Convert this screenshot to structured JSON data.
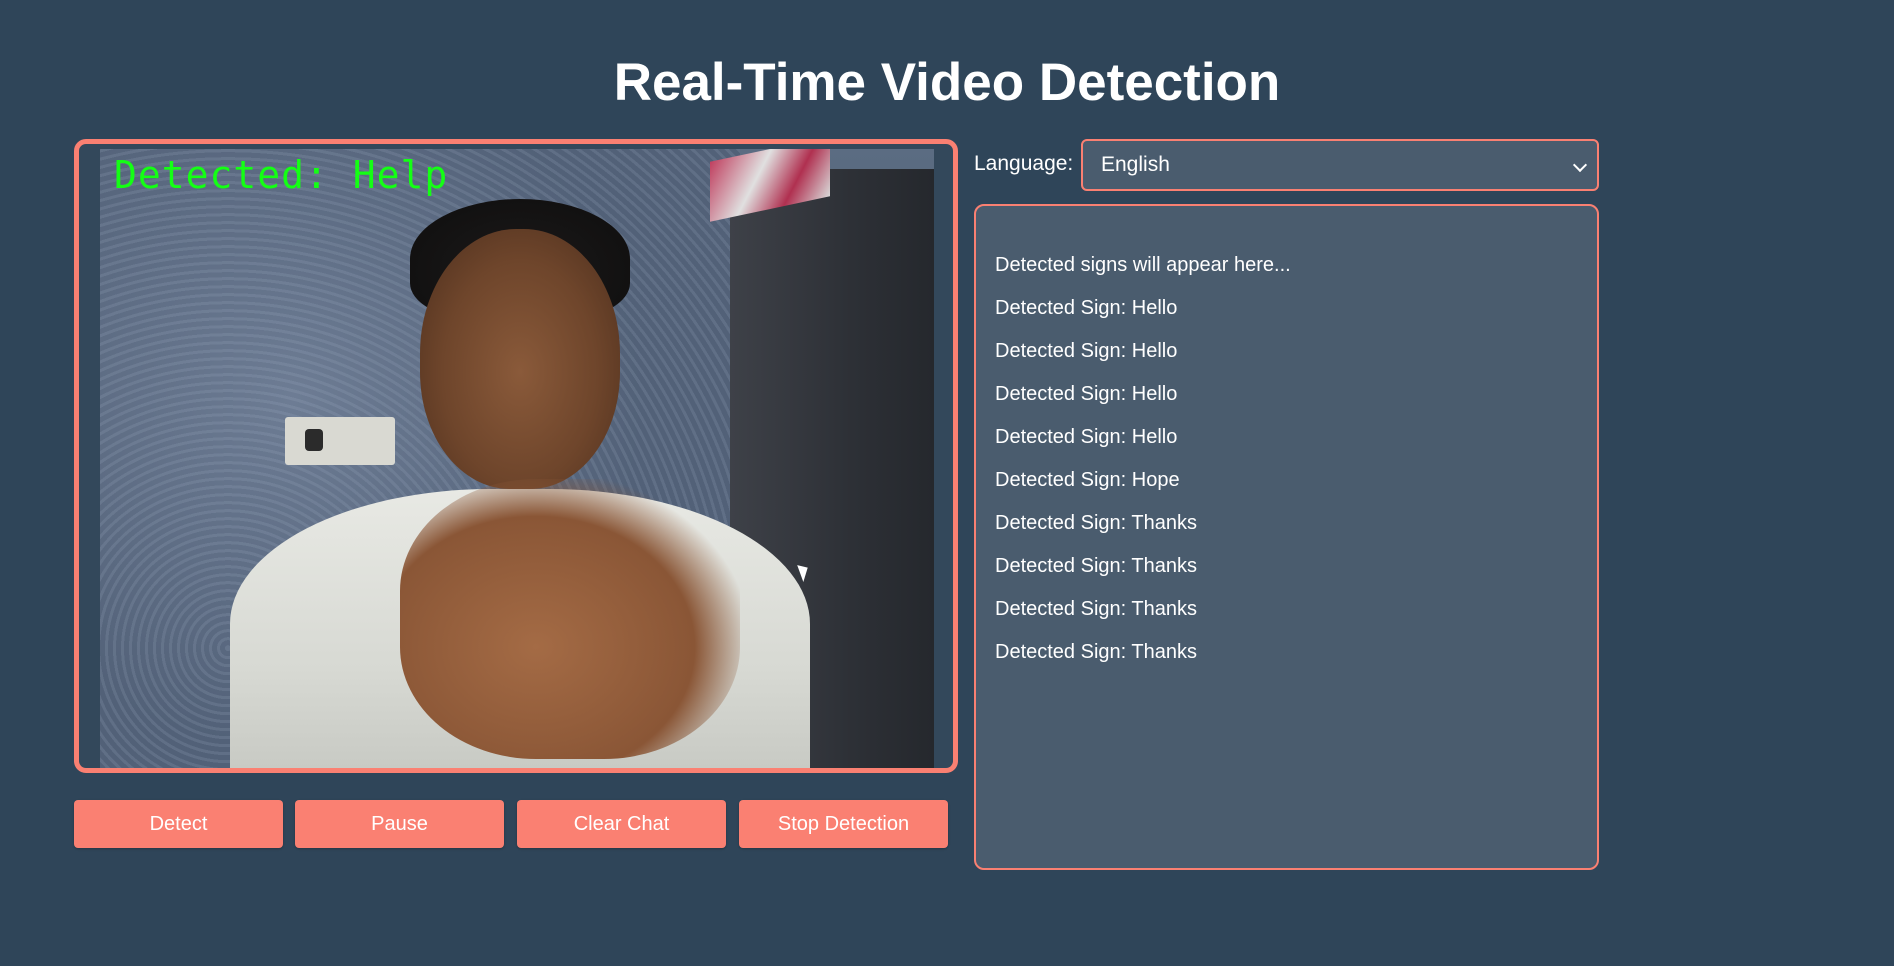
{
  "page": {
    "title": "Real-Time Video Detection"
  },
  "video": {
    "overlay_text": "Detected: Help",
    "accent_color": "#14ff14"
  },
  "controls": {
    "detect_label": "Detect",
    "pause_label": "Pause",
    "clear_chat_label": "Clear Chat",
    "stop_detection_label": "Stop Detection"
  },
  "language": {
    "label": "Language:",
    "selected": "English"
  },
  "chat": {
    "placeholder": "Detected signs will appear here...",
    "messages": [
      "Detected Sign: Hello",
      "Detected Sign: Hello",
      "Detected Sign: Hello",
      "Detected Sign: Hello",
      "Detected Sign: Hope",
      "Detected Sign: Thanks",
      "Detected Sign: Thanks",
      "Detected Sign: Thanks",
      "Detected Sign: Thanks"
    ]
  },
  "colors": {
    "background": "#2f4559",
    "accent": "#fa8072",
    "panel": "#4a5c6e",
    "text": "#ffffff"
  }
}
